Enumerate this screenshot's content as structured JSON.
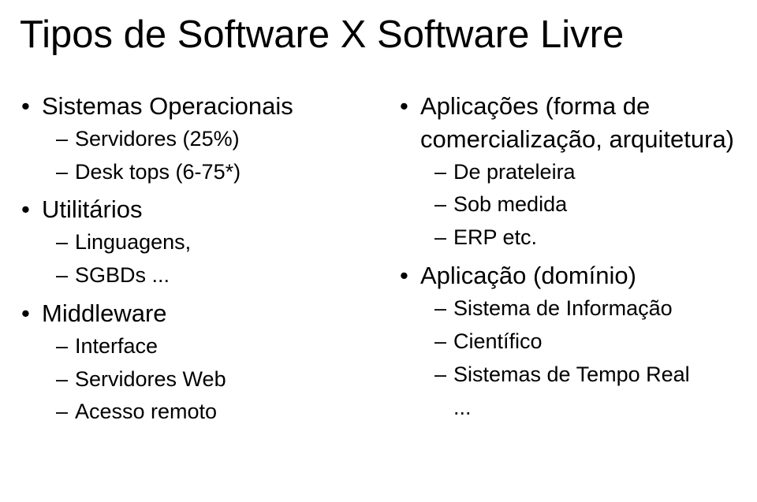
{
  "title": "Tipos de Software X Software Livre",
  "left": {
    "g1": {
      "heading": "Sistemas Operacionais",
      "items": [
        "Servidores (25%)",
        "Desk tops (6-75*)"
      ]
    },
    "g2": {
      "heading": "Utilitários",
      "items": [
        "Linguagens,",
        "SGBDs ..."
      ]
    },
    "g3": {
      "heading": "Middleware",
      "items": [
        "Interface",
        "Servidores Web",
        "Acesso remoto"
      ]
    }
  },
  "right": {
    "g1": {
      "heading": "Aplicações (forma de comercialização, arquitetura)",
      "items": [
        "De prateleira",
        "Sob medida",
        "ERP etc."
      ]
    },
    "g2": {
      "heading": "Aplicação (domínio)",
      "items": [
        "Sistema de Informação",
        "Científico",
        "Sistemas de Tempo Real"
      ]
    },
    "trailing": "..."
  }
}
